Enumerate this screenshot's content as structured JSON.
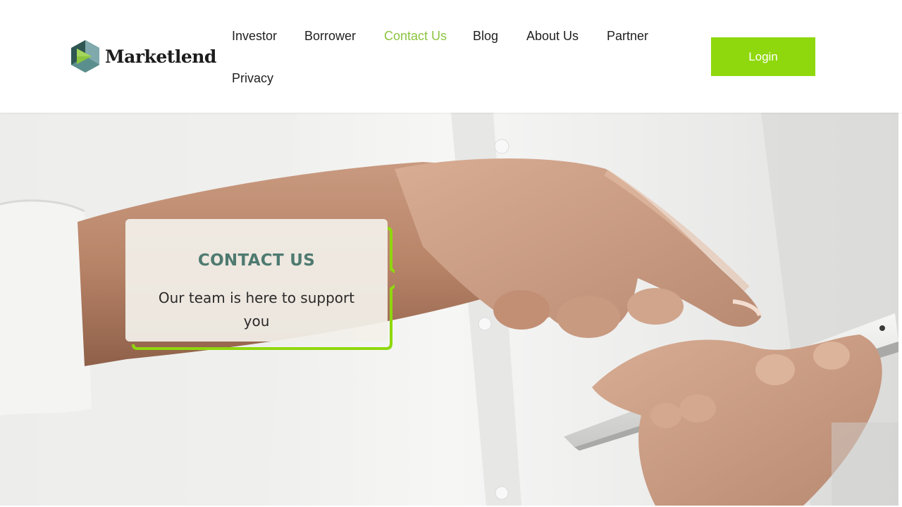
{
  "brand": {
    "name": "Marketlend",
    "logo_icon": "play-triangle-logo-icon",
    "colors": {
      "dark_teal": "#3f6b68",
      "light_teal": "#7fa9ad",
      "lime": "#8cc63f"
    }
  },
  "nav": {
    "items": [
      {
        "label": "Investor",
        "active": false
      },
      {
        "label": "Borrower",
        "active": false
      },
      {
        "label": "Contact Us",
        "active": true
      },
      {
        "label": "Blog",
        "active": false
      },
      {
        "label": "About Us",
        "active": false
      },
      {
        "label": "Partner",
        "active": false
      },
      {
        "label": "Privacy",
        "active": false
      }
    ],
    "login_label": "Login"
  },
  "hero": {
    "title": "CONTACT US",
    "subtitle": "Our team is here to support you",
    "image": "hand-tapping-smartphone-photo"
  },
  "colors": {
    "accent_green": "#8fd80d",
    "active_link": "#8bc53f",
    "callout_title": "#4e7a70",
    "callout_border": "#8fd80d"
  }
}
